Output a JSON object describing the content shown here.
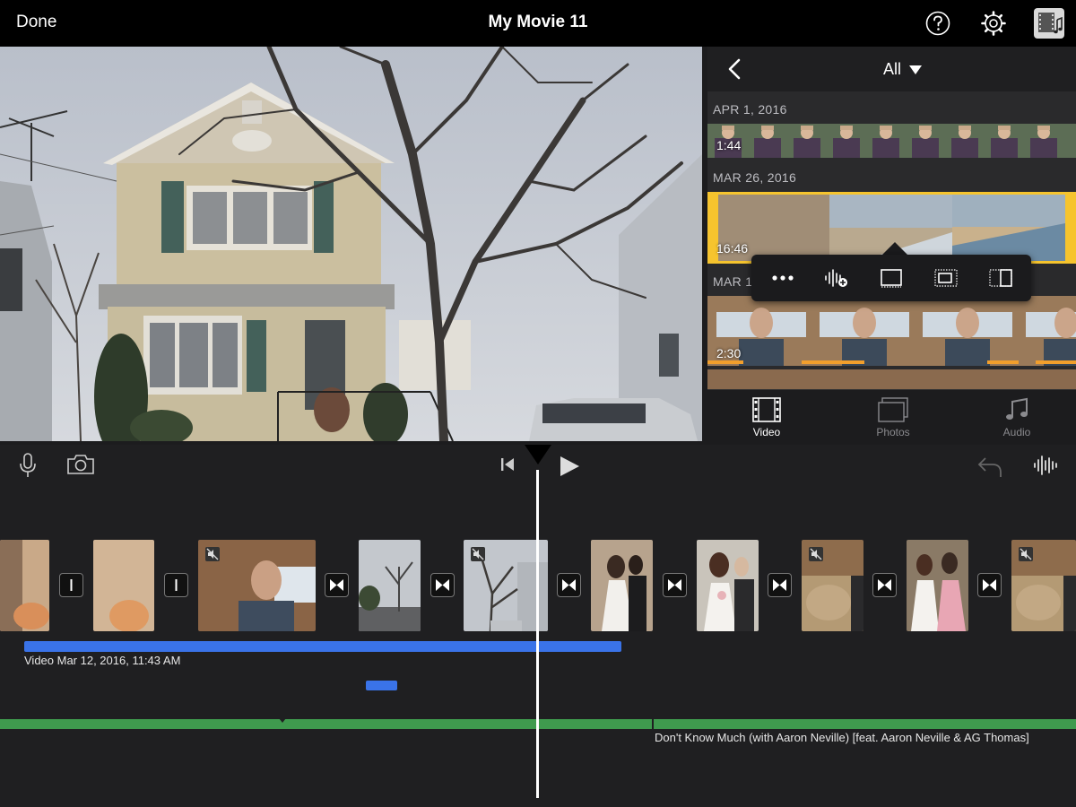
{
  "topbar": {
    "done_label": "Done",
    "title": "My Movie 11",
    "icons": [
      "help-icon",
      "settings-gear-icon",
      "project-media-icon"
    ]
  },
  "browser": {
    "filter_label": "All",
    "sections": [
      {
        "date": "APR 1, 2016",
        "duration": "1:44"
      },
      {
        "date": "MAR 26, 2016",
        "duration": "16:46"
      },
      {
        "date": "MAR 12, 2016",
        "duration": "2:30"
      }
    ],
    "tabs": [
      {
        "label": "Video",
        "icon": "film-icon",
        "selected": true
      },
      {
        "label": "Photos",
        "icon": "photos-icon",
        "selected": false
      },
      {
        "label": "Audio",
        "icon": "music-note-icon",
        "selected": false
      }
    ],
    "popover_actions": [
      "more-icon",
      "audio-only-add-icon",
      "insert-icon",
      "picture-in-picture-icon",
      "split-screen-icon"
    ]
  },
  "timeline": {
    "video_track_label": "Video Mar 12, 2016, 11:43 AM",
    "music_track_label": "Don't Know Much (with Aaron Neville) [feat. Aaron Neville & AG Thomas]",
    "accent_blue": "#3a73e8",
    "accent_green": "#3f9a4e",
    "selection_yellow": "#f6c42e"
  }
}
